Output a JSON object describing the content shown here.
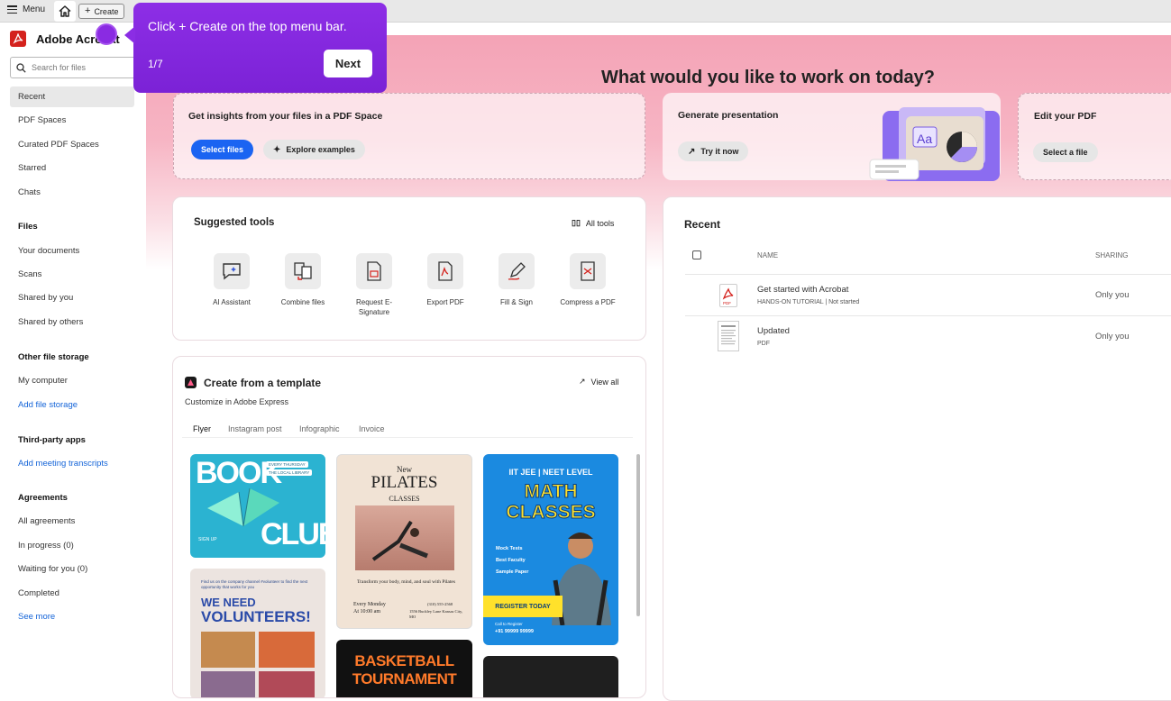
{
  "topbar": {
    "menu_label": "Menu",
    "create_label": "Create"
  },
  "sidebar": {
    "brand": "Adobe Acrobat",
    "search_placeholder": "Search for files",
    "items": [
      {
        "label": "Recent",
        "active": true
      },
      {
        "label": "PDF Spaces"
      },
      {
        "label": "Curated PDF Spaces"
      },
      {
        "label": "Starred"
      },
      {
        "label": "Chats"
      }
    ],
    "files_head": "Files",
    "files": [
      "Your documents",
      "Scans",
      "Shared by you",
      "Shared by others"
    ],
    "storage_head": "Other file storage",
    "storage": [
      "My computer"
    ],
    "storage_link": "Add file storage",
    "third_head": "Third-party apps",
    "third_link": "Add meeting transcripts",
    "agreements_head": "Agreements",
    "agreements": [
      "All agreements",
      "In progress (0)",
      "Waiting for you (0)",
      "Completed"
    ],
    "see_more": "See more"
  },
  "main": {
    "title": "What would you like to work on today?",
    "card_space": {
      "title": "Get insights from your files in a PDF Space",
      "primary": "Select files",
      "secondary": "Explore examples"
    },
    "card_present": {
      "title": "Generate presentation",
      "button": "Try it now"
    },
    "card_edit": {
      "title": "Edit your PDF",
      "button": "Select a file"
    },
    "tools": {
      "title": "Suggested tools",
      "all_tools": "All tools",
      "items": [
        {
          "label": "AI Assistant",
          "icon": "ai-assistant-icon"
        },
        {
          "label": "Combine files",
          "icon": "combine-files-icon"
        },
        {
          "label": "Request E-Signature",
          "icon": "request-esignature-icon"
        },
        {
          "label": "Export PDF",
          "icon": "export-pdf-icon"
        },
        {
          "label": "Fill & Sign",
          "icon": "fill-sign-icon"
        },
        {
          "label": "Compress a PDF",
          "icon": "compress-pdf-icon"
        }
      ]
    },
    "templates": {
      "title": "Create from a template",
      "subtitle": "Customize in Adobe Express",
      "view_all": "View all",
      "tabs": [
        "Flyer",
        "Instagram post",
        "Infographic",
        "Invoice"
      ],
      "book": {
        "line1": "BOOK",
        "line2": "CLUB",
        "tag": "EVERY THURSDAY",
        "tag2": "THE LOCAL LIBRARY",
        "sign": "SIGN UP"
      },
      "pilates": {
        "new": "New",
        "title": "PILATES",
        "classes": "CLASSES",
        "tagline": "Transform your body, mind, and soul with Pilates",
        "when": "Every Monday",
        "time": "At 10:00 am",
        "phone": "(310) 555-2568",
        "address": "1556 Buckley Lane Kansas City, MO"
      },
      "math": {
        "top": "IIT JEE | NEET LEVEL",
        "title1": "MATH",
        "title2": "CLASSES",
        "b1": "Mock Tests",
        "b2": "Best Faculty",
        "b3": "Sample Paper",
        "cta": "REGISTER TODAY",
        "call": "Call to Register",
        "phone": "+91 99999 99999"
      },
      "volunteer": {
        "small": "Find us on the company channel #volunteer to find the next opportunity that works for you",
        "line1": "WE NEED",
        "line2": "VOLUNTEERS!"
      },
      "basketball": {
        "line1": "BASKETBALL",
        "line2": "TOURNAMENT"
      }
    },
    "recent": {
      "title": "Recent",
      "col_name": "NAME",
      "col_sharing": "SHARING",
      "rows": [
        {
          "name": "Get started with Acrobat",
          "meta": "HANDS-ON TUTORIAL | Not started",
          "sharing": "Only you"
        },
        {
          "name": "Updated",
          "meta": "PDF",
          "sharing": "Only you"
        }
      ]
    }
  },
  "tour": {
    "text": "Click + Create on the top menu bar.",
    "step": "1/7",
    "next": "Next"
  },
  "colors": {
    "accent": "#1b64f2",
    "acrobat_red": "#d4221d",
    "tour_purple": "#8a2be2"
  }
}
